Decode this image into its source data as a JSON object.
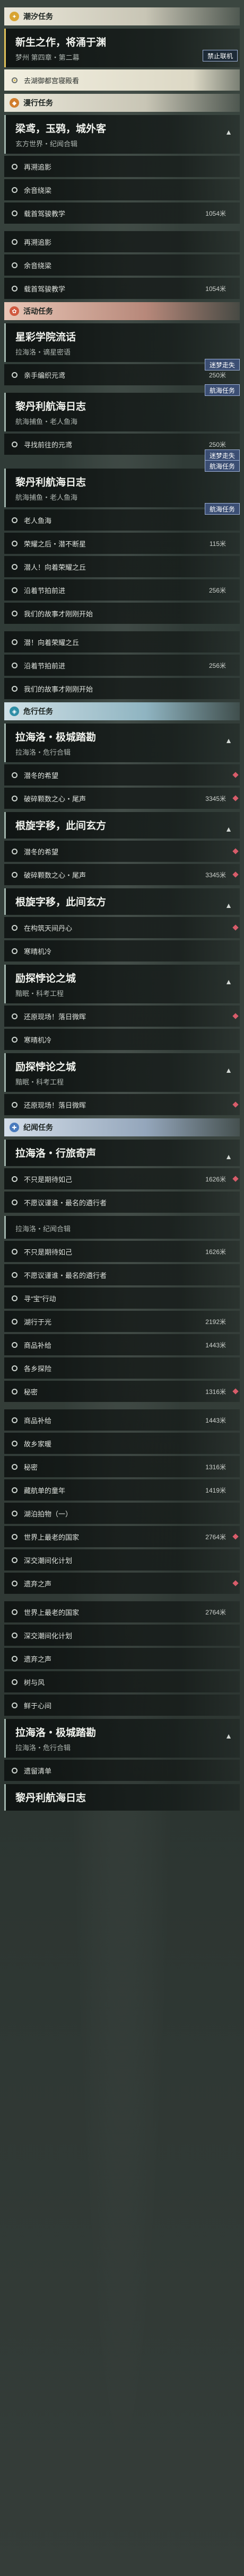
{
  "sections": {
    "tide": "潮汐任务",
    "roaming": "漫行任务",
    "event": "活动任务",
    "danger": "危行任务",
    "chronicle": "纪闻任务"
  },
  "tags": {
    "no_online": "禁止联机",
    "dream_lost": "迷梦走失",
    "nav_sea": "航海任务"
  },
  "q1": {
    "title": "新生之作，将涌于渊",
    "sub": "梦州 第四章・第二幕",
    "obj1": "去湖御都宫寝殿看"
  },
  "q2": {
    "title": "梁鸢，玉鸦，城外客",
    "sub": "玄方世界・纪闻合辑",
    "objs": [
      "再溯追影",
      "余音绕梁",
      "载首驾骏教学"
    ],
    "dist": "1054米"
  },
  "q2b": {
    "objs": [
      "再溯追影",
      "余音绕梁",
      "载首驾骏教学"
    ],
    "dist": "1054米"
  },
  "q3": {
    "title": "星彩学院流话",
    "sub": "拉海洛・谪星密语",
    "objs": [
      "亲手编织元鸢",
      "寻找前往的元鸢"
    ],
    "dist1": "250米",
    "dist2": "250米"
  },
  "q4": {
    "title": "黎丹利航海日志",
    "sub": "航海捕鱼・老人鱼海",
    "objs": [
      "老人鱼海",
      "荣耀之后・潜不断星",
      "潜人！向着荣耀之丘",
      "沿着节拍前进",
      "我们的故事才刚刚开始"
    ],
    "d1": "115米",
    "d2": "256米"
  },
  "q4b": {
    "objs": [
      "潜！向着荣耀之丘",
      "沿着节拍前进",
      "我们的故事才刚刚开始"
    ],
    "d": "256米"
  },
  "q5": {
    "title": "拉海洛・极城踏勘",
    "sub": "拉海洛・危行合辑",
    "objs": [
      "潜冬的希望",
      "破碎颗数之心・尾声"
    ],
    "dist": "3345米"
  },
  "q6": {
    "title": "根旋字移，此间玄方",
    "objs": [
      "潜冬的希望",
      "破碎颗数之心・尾声"
    ],
    "dist": "3345米"
  },
  "q7": {
    "title": "根旋字移，此间玄方",
    "objs": [
      "在构筑天间丹心",
      "寒晴机冷"
    ]
  },
  "q8": {
    "title": "励探悖论之城",
    "sub": "黯眠・科考工程",
    "objs": [
      "还原现场！落日微晖",
      "寒晴机冷"
    ]
  },
  "q9": {
    "title": "励探悖论之城",
    "sub": "黯眠・科考工程",
    "objs": [
      "还原现场！落日微晖"
    ]
  },
  "q10": {
    "title": "拉海洛・行旅奇声",
    "sub": "拉海洛・纪闻合辑",
    "objs": [
      "不只是期待如己",
      "不愿议谨谁・最名的遴行者"
    ],
    "dist": "1626米"
  },
  "q10b": {
    "sub": "拉海洛・纪闻合辑",
    "objs": [
      "不只是期待如己",
      "不愿议谨谁・最名的遴行者",
      "寻“宝”行动",
      "湖行于光",
      "商品补给",
      "各乡探险",
      "秘密",
      "商品补给",
      "故乡家暖",
      "秘密",
      "藏航单的童年",
      "湖泊拍物（一）",
      "世界上最老的国家",
      "深交潮间化计划",
      "遗弃之声"
    ],
    "d": [
      "1626米",
      "2192米",
      "1443米",
      "1316米",
      "1316米",
      "1443米",
      "1419米",
      "2764米"
    ]
  },
  "q10c": {
    "objs": [
      "世界上最老的国家",
      "深交潮间化计划",
      "遗弃之声",
      "树与风",
      "鲜于心间"
    ],
    "d": "2764米"
  },
  "q11": {
    "title": "拉海洛・极城踏勘",
    "sub": "拉海洛・危行合辑",
    "objs": [
      "遗留清单"
    ]
  },
  "q12": {
    "title": "黎丹利航海日志"
  }
}
